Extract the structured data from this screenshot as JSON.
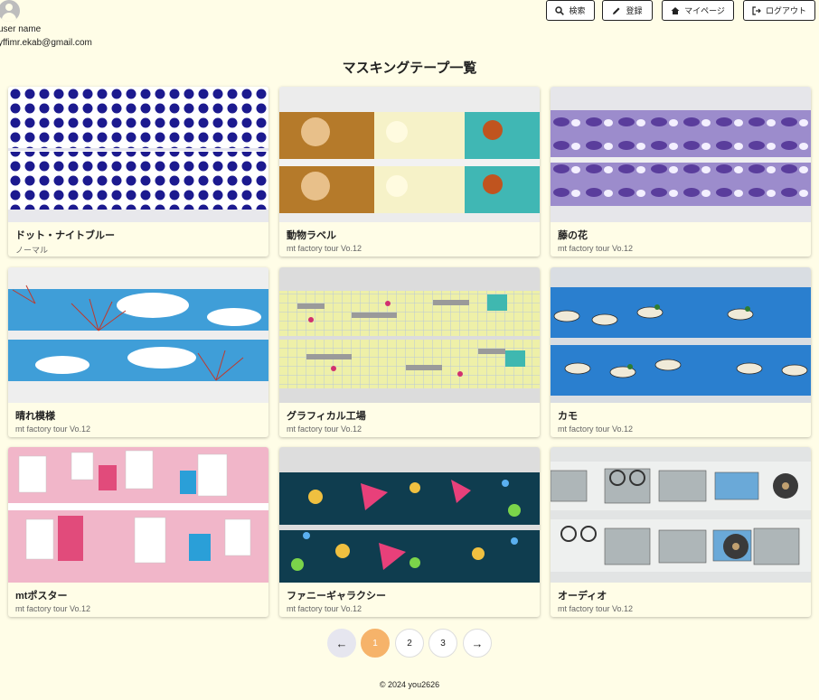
{
  "user": {
    "name": "user name",
    "email": "yffimr.ekab@gmail.com"
  },
  "nav": {
    "search": "検索",
    "register": "登録",
    "mypage": "マイページ",
    "logout": "ログアウト"
  },
  "page_title": "マスキングテープ一覧",
  "cards": [
    {
      "title": "ドット・ナイトブルー",
      "subtitle": "ノーマル"
    },
    {
      "title": "動物ラベル",
      "subtitle": "mt factory tour Vo.12"
    },
    {
      "title": "藤の花",
      "subtitle": "mt factory tour Vo.12"
    },
    {
      "title": "晴れ模様",
      "subtitle": "mt factory tour Vo.12"
    },
    {
      "title": "グラフィカル工場",
      "subtitle": "mt factory tour Vo.12"
    },
    {
      "title": "カモ",
      "subtitle": "mt factory tour Vo.12"
    },
    {
      "title": "mtポスター",
      "subtitle": "mt factory tour Vo.12"
    },
    {
      "title": "ファニーギャラクシー",
      "subtitle": "mt factory tour Vo.12"
    },
    {
      "title": "オーディオ",
      "subtitle": "mt factory tour Vo.12"
    }
  ],
  "pagination": {
    "prev": "←",
    "pages": [
      "1",
      "2",
      "3"
    ],
    "current": "1",
    "next": "→"
  },
  "footer": "© 2024 you2626",
  "colors": {
    "background": "#fffde7",
    "active_page": "#f6b36a"
  }
}
